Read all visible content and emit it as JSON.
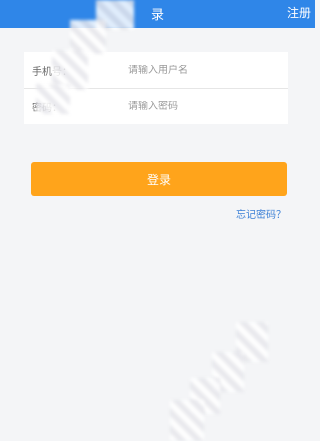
{
  "header": {
    "title": "录",
    "register_label": "注册"
  },
  "form": {
    "username_label": "手机号：",
    "username_placeholder": "请输入用户名",
    "password_label": "密码：",
    "password_placeholder": "请输入密码"
  },
  "actions": {
    "login_label": "登录",
    "forgot_label": "忘记密码？"
  },
  "colors": {
    "header_bg": "#2f86e8",
    "login_button_bg": "#ffa41b",
    "link_color": "#3a7fd6"
  }
}
